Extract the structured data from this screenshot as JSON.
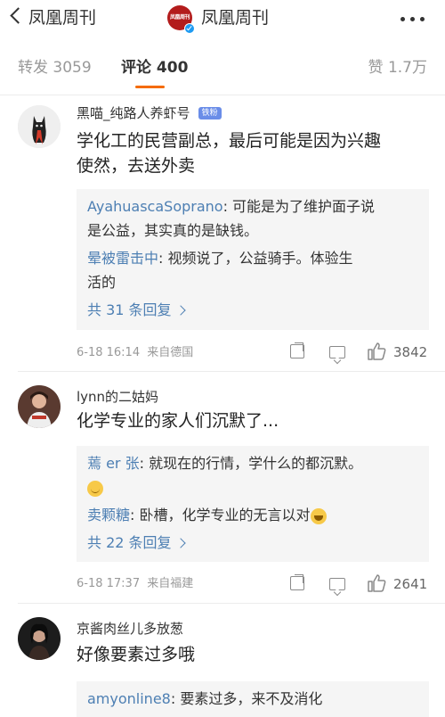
{
  "header": {
    "back_label": "凤凰周刊",
    "title": "凤凰周刊",
    "logo_text": "凤凰周刊"
  },
  "tabs": {
    "repost": "转发 3059",
    "comment": "评论 400",
    "like": "赞 1.7万"
  },
  "comments": [
    {
      "name": "黑喵_纯路人养虾号",
      "badge": "铁粉",
      "body_line1": "学化工的民营副总，最后可能是因为兴趣",
      "body_line2": "使然，去送外卖",
      "replies": [
        {
          "name": "AyahuascaSoprano",
          "text_line1": ": 可能是为了维护面子说",
          "text_line2": "是公益，其实真的是缺钱。"
        },
        {
          "name": "晕被雷击中",
          "text_line1": ": 视频说了，公益骑手。体验生",
          "text_line2": "活的"
        }
      ],
      "more_replies": "共 31 条回复",
      "time": "6-18 16:14",
      "source": "来自德国",
      "likes": "3842"
    },
    {
      "name": "lynn的二姑妈",
      "body_line1": "化学专业的家人们沉默了...",
      "replies": [
        {
          "name": "蔫 er 张",
          "text_line1": ": 就现在的行情，学什么的都沉默。"
        },
        {
          "name": "卖颗糖",
          "text_line1": ": 卧槽，化学专业的无言以对"
        }
      ],
      "more_replies": "共 22 条回复",
      "time": "6-18 17:37",
      "source": "来自福建",
      "likes": "2641"
    },
    {
      "name": "京酱肉丝儿多放葱",
      "body_line1": "好像要素过多哦",
      "replies": [
        {
          "name": "amyonline8",
          "text_line1": ": 要素过多，来不及消化"
        }
      ]
    }
  ],
  "colors": {
    "accent": "#f56b00",
    "link": "#4d7fb3",
    "brand": "#b31c1c"
  }
}
